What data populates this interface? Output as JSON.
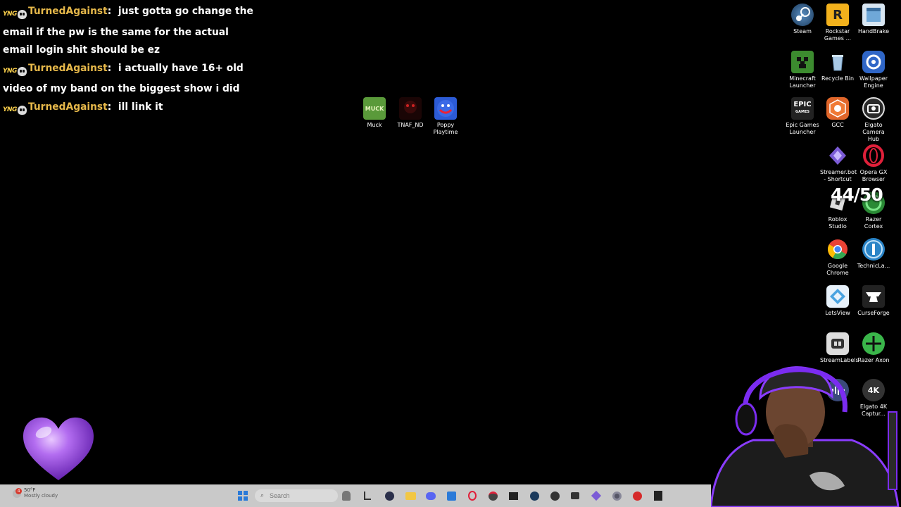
{
  "chat": {
    "messages": [
      {
        "badge_tag": "YNG",
        "user": "TurnedAgainst",
        "text": "just gotta go change the email if the pw is the same for the actual email login shit should be ez"
      },
      {
        "badge_tag": "YNG",
        "user": "TurnedAgainst",
        "text": "i actually have 16+ old video of my band on the biggest show i did"
      },
      {
        "badge_tag": "YNG",
        "user": "TurnedAgainst",
        "text": "ill link it"
      }
    ]
  },
  "desktop": {
    "center_icons": [
      {
        "label": "Muck",
        "icon": "muck-icon",
        "color": "#4a8a3a"
      },
      {
        "label": "TNAF_ND",
        "icon": "tnaf-icon",
        "color": "#2a0a0a"
      },
      {
        "label": "Poppy Playtime",
        "icon": "poppy-playtime-icon",
        "color": "#2c5bd6"
      }
    ],
    "right_icons": [
      {
        "label": "Steam",
        "icon": "steam-icon",
        "color": "#1b3a5c"
      },
      {
        "label": "Rockstar Games ...",
        "icon": "rockstar-icon",
        "color": "#f2b11c"
      },
      {
        "label": "HandBrake",
        "icon": "handbrake-icon",
        "color": "#6fa8d8"
      },
      {
        "label": "Minecraft Launcher",
        "icon": "minecraft-icon",
        "color": "#3c8b2f"
      },
      {
        "label": "Recycle Bin",
        "icon": "recycle-bin-icon",
        "color": "#8fb7d9"
      },
      {
        "label": "Wallpaper Engine",
        "icon": "wallpaper-engine-icon",
        "color": "#2f66c7"
      },
      {
        "label": "Epic Games Launcher",
        "icon": "epic-games-icon",
        "color": "#222222"
      },
      {
        "label": "GCC",
        "icon": "gcc-icon",
        "color": "#e0662a"
      },
      {
        "label": "Elgato Camera Hub",
        "icon": "elgato-camera-hub-icon",
        "color": "#2a2a2a"
      },
      {
        "label": "Streamer.bot - Shortcut",
        "icon": "streamerbot-icon",
        "color": "#7b5bd6"
      },
      {
        "label": "Opera GX Browser",
        "icon": "opera-gx-icon",
        "color": "#d8203a"
      },
      {
        "label": "Roblox Studio",
        "icon": "roblox-studio-icon",
        "color": "#3a3a3a"
      },
      {
        "label": "Razer Cortex",
        "icon": "razer-cortex-icon",
        "color": "#3ab54a"
      },
      {
        "label": "Google Chrome",
        "icon": "chrome-icon",
        "color": "#e94235"
      },
      {
        "label": "TechnicLa...",
        "icon": "technic-launcher-icon",
        "color": "#2a84c7"
      },
      {
        "label": "LetsView",
        "icon": "letsview-icon",
        "color": "#4aa3e0"
      },
      {
        "label": "CurseForge",
        "icon": "curseforge-icon",
        "color": "#222222"
      },
      {
        "label": "StreamLabels",
        "icon": "streamlabels-icon",
        "color": "#555555"
      },
      {
        "label": "Razer Axon",
        "icon": "razer-axon-icon",
        "color": "#3ab54a"
      },
      {
        "label": "",
        "icon": "audio-wave-icon",
        "color": "#3a4a7a"
      },
      {
        "label": "Elgato 4K Captur...",
        "icon": "elgato-4k-icon",
        "color": "#333333"
      }
    ]
  },
  "counter": {
    "text": "44/50"
  },
  "taskbar": {
    "weather_temp": "50°F",
    "weather_desc": "Mostly cloudy",
    "weather_badge": "4",
    "search_placeholder": "Search"
  },
  "colors": {
    "desktop_bg": "#000000",
    "username": "#e6b84a",
    "taskbar_bg": "#c9c9c9",
    "webcam_border": "#7b2cf0",
    "heart": "#9b4de0"
  }
}
